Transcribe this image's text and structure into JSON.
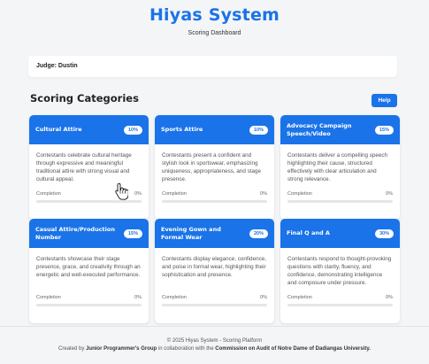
{
  "header": {
    "title": "Hiyas System",
    "subtitle": "Scoring Dashboard"
  },
  "judge": {
    "label": "Judge: Dustin"
  },
  "section": {
    "title": "Scoring Categories",
    "help_label": "Help"
  },
  "completion_label": "Completion",
  "categories": [
    {
      "title": "Cultural Attire",
      "weight": "10%",
      "description": "Contestants celebrate cultural heritage through expressive and meaningful traditional attire with strong visual and cultural appeal.",
      "completion": "0%",
      "completion_value": 0
    },
    {
      "title": "Sports Attire",
      "weight": "10%",
      "description": "Contestants present a confident and stylish look in sportswear, emphasizing uniqueness, appropriateness, and stage presence.",
      "completion": "0%",
      "completion_value": 0
    },
    {
      "title": "Advocacy Campaign Speech/Video",
      "weight": "15%",
      "description": "Contestants deliver a compelling speech highlighting their cause, structured effectively with clear articulation and strong relevance.",
      "completion": "0%",
      "completion_value": 0
    },
    {
      "title": "Casual Attire/Production Number",
      "weight": "15%",
      "description": "Contestants showcase their stage presence, grace, and creativity through an energetic and well-executed performance.",
      "completion": "0%",
      "completion_value": 0
    },
    {
      "title": "Evening Gown and Formal Wear",
      "weight": "20%",
      "description": "Contestants display elegance, confidence, and poise in formal wear, highlighting their sophistication and presence.",
      "completion": "0%",
      "completion_value": 0
    },
    {
      "title": "Final Q and A",
      "weight": "30%",
      "description": "Contestants respond to thought-provoking questions with clarity, fluency, and confidence, demonstrating intelligence and composure under pressure.",
      "completion": "0%",
      "completion_value": 0
    }
  ],
  "footer": {
    "line1": "© 2025 Hiyas System - Scoring Platform",
    "line2_prefix": "Created by ",
    "line2_group": "Junior Programmer's Group",
    "line2_mid": " in collaboration with the ",
    "line2_org": "Commission on Audit of Notre Dame of Dadiangas University."
  },
  "colors": {
    "accent": "#1a73e8",
    "background": "#f4f5f7"
  }
}
